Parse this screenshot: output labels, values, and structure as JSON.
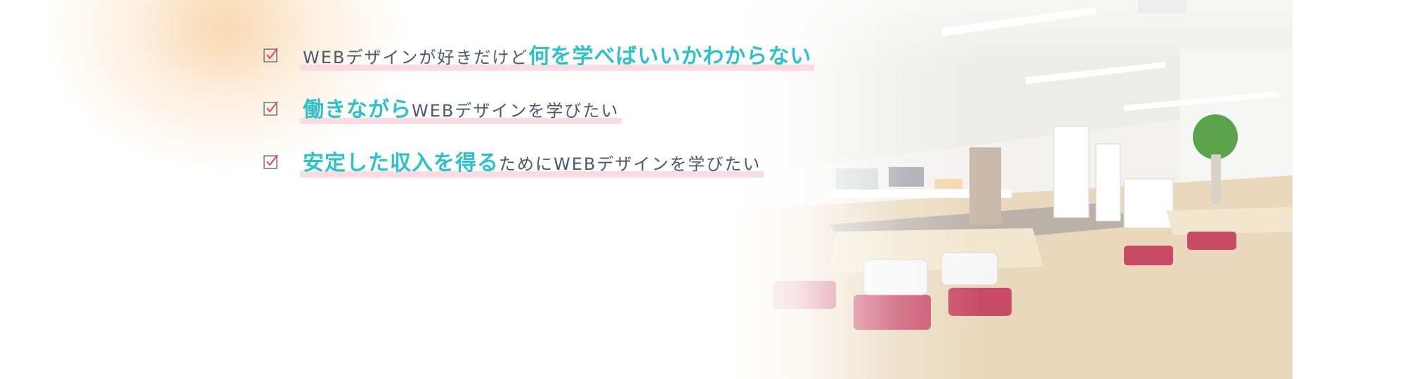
{
  "checklist": {
    "items": [
      {
        "prefix": "WEBデザインが好きだけど",
        "emphasis": "何を学べばいいかわからない",
        "suffix": ""
      },
      {
        "prefix": "",
        "emphasis": "働きながら",
        "suffix": "WEBデザインを学びたい"
      },
      {
        "prefix": "",
        "emphasis": "安定した収入を得る",
        "suffix": "ためにWEBデザインを学びたい"
      }
    ]
  },
  "colors": {
    "accent": "#2cc2cc",
    "text": "#4a5a6e",
    "highlight": "#fcd6de",
    "check_box": "#6b7585",
    "check_mark": "#e04a5a",
    "glow": "#f7cc96"
  },
  "icons": {
    "check": "checkbox-checked-icon"
  },
  "image": {
    "subject": "office-lounge-photo"
  }
}
